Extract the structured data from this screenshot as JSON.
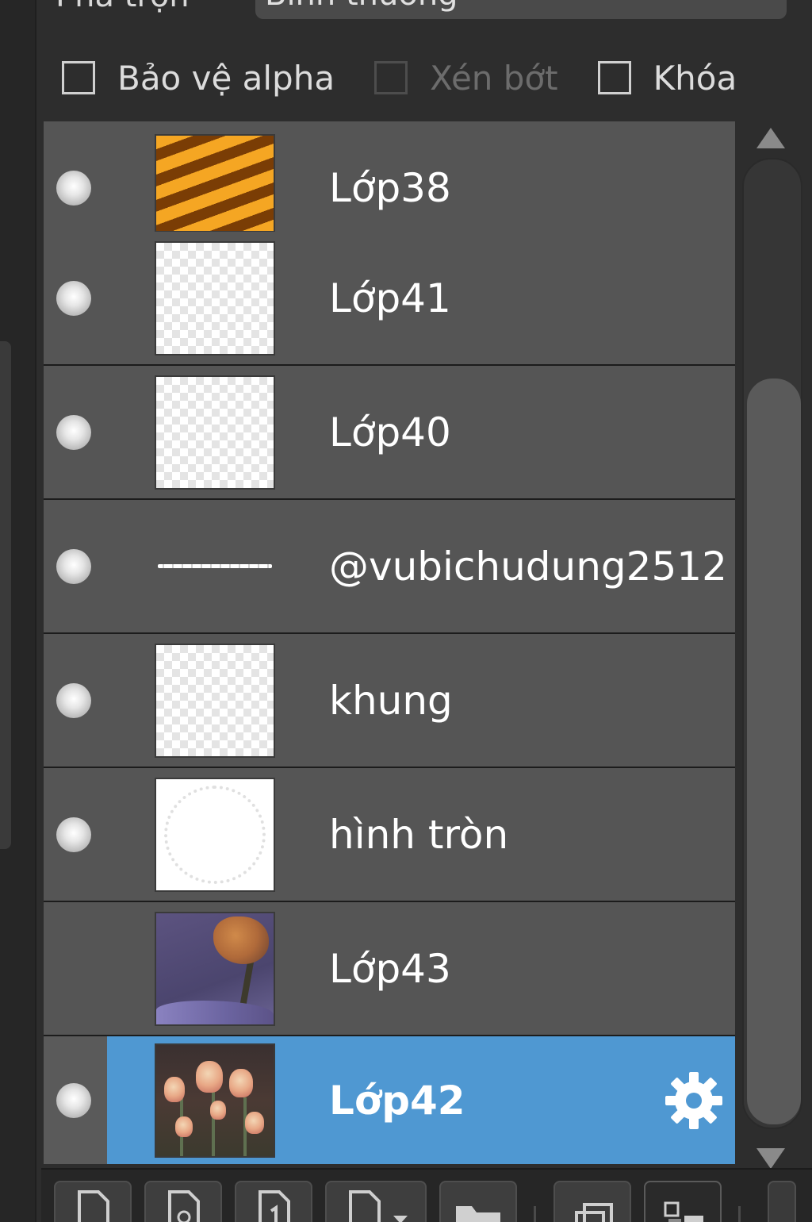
{
  "blend": {
    "label": "Pha trộn",
    "mode": "Bình thường"
  },
  "options": [
    {
      "label": "Bảo vệ alpha",
      "checked": false,
      "enabled": true
    },
    {
      "label": "Xén bớt",
      "checked": false,
      "enabled": false
    },
    {
      "label": "Khóa",
      "checked": false,
      "enabled": true
    }
  ],
  "layers": [
    {
      "name": "Lớp38",
      "visible": true,
      "thumbnail": "orange-stripes"
    },
    {
      "name": "Lớp41",
      "visible": true,
      "thumbnail": "transparent"
    },
    {
      "name": "Lớp40",
      "visible": true,
      "thumbnail": "transparent"
    },
    {
      "name": "@vubichudung2512",
      "visible": true,
      "thumbnail": "signature-text"
    },
    {
      "name": "khung",
      "visible": true,
      "thumbnail": "transparent"
    },
    {
      "name": "hình tròn",
      "visible": true,
      "thumbnail": "white-circle"
    },
    {
      "name": "Lớp43",
      "visible": false,
      "thumbnail": "purple-flower-photo"
    },
    {
      "name": "Lớp42",
      "visible": true,
      "thumbnail": "tulips-photo",
      "selected": true
    }
  ],
  "colors": {
    "selection": "#4f98d2",
    "row": "#555555",
    "background": "#2d2d2d"
  },
  "icons": {
    "visibility": "eye-dot-icon",
    "layer_settings": "gear-icon",
    "scroll_up": "arrow-up-icon",
    "scroll_down": "arrow-down-icon",
    "toolbar": [
      "new-layer-icon",
      "new-layer-from-file-icon",
      "duplicate-layer-icon",
      "new-layer-menu-icon",
      "new-folder-icon",
      "merge-layers-icon",
      "flatten-icon"
    ]
  }
}
